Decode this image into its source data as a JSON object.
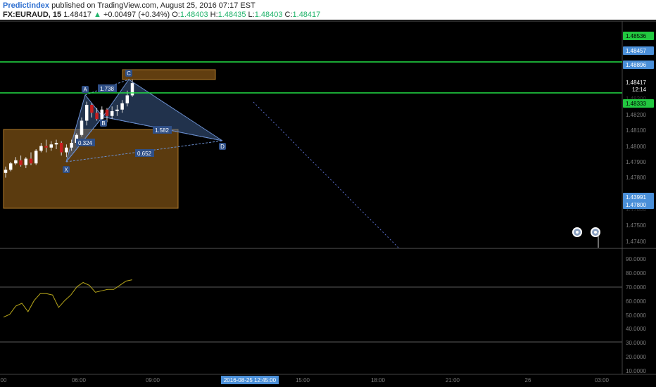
{
  "header": {
    "publisher": "Predictindex",
    "published_text": "published on TradingView.com, August 25, 2016 07:17 EST",
    "symbol": "FX:EURAUD, 15",
    "last": "1.48417",
    "change": "+0.00497 (+0.34%)",
    "o_label": "O:",
    "o": "1.48403",
    "h_label": "H:",
    "h": "1.48435",
    "l_label": "L:",
    "l": "1.48403",
    "c_label": "C:",
    "c": "1.48417"
  },
  "price_axis": {
    "ticks": [
      "1.48200",
      "1.48100",
      "1.48000",
      "1.47900",
      "1.47800",
      "1.47500",
      "1.47400"
    ],
    "faded_ticks": [
      "1.48300",
      "1.47800"
    ],
    "labels": [
      {
        "text": "1.48536",
        "style": "green"
      },
      {
        "text": "1.48457",
        "style": "blue"
      },
      {
        "text": "1.48896",
        "style": "blue"
      },
      {
        "text": "1.48417",
        "style": "price"
      },
      {
        "text": "12:14",
        "style": "timer"
      },
      {
        "text": "1.48333",
        "style": "green"
      },
      {
        "text": "1.43991",
        "style": "blue"
      },
      {
        "text": "1.47800",
        "style": "blue"
      }
    ]
  },
  "osc_axis": {
    "ticks": [
      "90.0000",
      "80.0000",
      "70.0000",
      "60.0000",
      "50.0000",
      "40.0000",
      "30.0000",
      "20.0000",
      "10.0000"
    ]
  },
  "time_axis": {
    "ticks": [
      "00",
      "06:00",
      "09:00",
      "15:00",
      "18:00",
      "21:00",
      "26",
      "03:00"
    ],
    "crosshair_label": "2016-08-25 12:45:00"
  },
  "pattern": {
    "points": [
      "X",
      "A",
      "B",
      "C",
      "D"
    ],
    "ratios": [
      "1.738",
      "0.324",
      "1.582",
      "0.652"
    ]
  },
  "chart_data": {
    "type": "candlestick",
    "symbol": "FX:EURAUD",
    "interval": "15",
    "candles": [
      {
        "o": 1.4785,
        "h": 1.4789,
        "l": 1.4782,
        "c": 1.4787
      },
      {
        "o": 1.4787,
        "h": 1.4792,
        "l": 1.4786,
        "c": 1.4791
      },
      {
        "o": 1.4791,
        "h": 1.4795,
        "l": 1.479,
        "c": 1.4793
      },
      {
        "o": 1.4793,
        "h": 1.4796,
        "l": 1.4789,
        "c": 1.479
      },
      {
        "o": 1.479,
        "h": 1.4795,
        "l": 1.4788,
        "c": 1.4794
      },
      {
        "o": 1.4794,
        "h": 1.4798,
        "l": 1.479,
        "c": 1.4791
      },
      {
        "o": 1.4791,
        "h": 1.48,
        "l": 1.479,
        "c": 1.4799
      },
      {
        "o": 1.4799,
        "h": 1.4804,
        "l": 1.4798,
        "c": 1.4802
      },
      {
        "o": 1.4802,
        "h": 1.4806,
        "l": 1.4798,
        "c": 1.4801
      },
      {
        "o": 1.4801,
        "h": 1.4805,
        "l": 1.4799,
        "c": 1.4803
      },
      {
        "o": 1.4803,
        "h": 1.4806,
        "l": 1.48,
        "c": 1.4804
      },
      {
        "o": 1.4804,
        "h": 1.4805,
        "l": 1.4796,
        "c": 1.4798
      },
      {
        "o": 1.4798,
        "h": 1.4803,
        "l": 1.4795,
        "c": 1.4801
      },
      {
        "o": 1.4801,
        "h": 1.4806,
        "l": 1.4799,
        "c": 1.4804
      },
      {
        "o": 1.4804,
        "h": 1.481,
        "l": 1.4803,
        "c": 1.4809
      },
      {
        "o": 1.4809,
        "h": 1.482,
        "l": 1.4808,
        "c": 1.4818
      },
      {
        "o": 1.4818,
        "h": 1.483,
        "l": 1.4815,
        "c": 1.4828
      },
      {
        "o": 1.4828,
        "h": 1.4829,
        "l": 1.482,
        "c": 1.4823
      },
      {
        "o": 1.4823,
        "h": 1.4826,
        "l": 1.4818,
        "c": 1.4819
      },
      {
        "o": 1.4819,
        "h": 1.4827,
        "l": 1.4817,
        "c": 1.4825
      },
      {
        "o": 1.4825,
        "h": 1.4826,
        "l": 1.4817,
        "c": 1.4821
      },
      {
        "o": 1.4821,
        "h": 1.4827,
        "l": 1.4819,
        "c": 1.4824
      },
      {
        "o": 1.4824,
        "h": 1.4828,
        "l": 1.4821,
        "c": 1.4825
      },
      {
        "o": 1.4825,
        "h": 1.4831,
        "l": 1.4823,
        "c": 1.4829
      },
      {
        "o": 1.4829,
        "h": 1.4837,
        "l": 1.4827,
        "c": 1.4834
      },
      {
        "o": 1.4834,
        "h": 1.4844,
        "l": 1.4833,
        "c": 1.48417
      }
    ],
    "horizontal_levels": [
      1.48457,
      1.48333
    ],
    "harmonic_pattern": {
      "X": 1.4787,
      "A": 1.4828,
      "B": 1.4816,
      "C": 1.4842,
      "D": 1.4801,
      "ratios": {
        "AB/XA": 0.324,
        "BC/AB": 1.738,
        "CD/BC": 1.582,
        "AD/XA": 0.652
      }
    },
    "zones": [
      {
        "from": 1.4778,
        "to": 1.4815
      },
      {
        "from": 1.4843,
        "to": 1.4847
      }
    ],
    "oscillator": {
      "ylim": [
        0,
        100
      ],
      "reference_lines": [
        70,
        30
      ],
      "values": [
        48,
        50,
        56,
        58,
        52,
        60,
        65,
        65,
        64,
        55,
        60,
        64,
        70,
        73,
        71,
        66,
        67,
        68,
        68,
        71,
        74,
        75
      ]
    }
  }
}
